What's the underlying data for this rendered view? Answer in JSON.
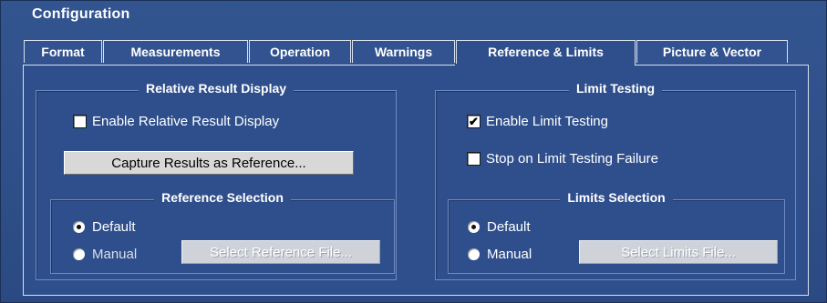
{
  "window": {
    "title": "Configuration"
  },
  "tabs": [
    {
      "label": "Format",
      "active": false
    },
    {
      "label": "Measurements",
      "active": false
    },
    {
      "label": "Operation",
      "active": false
    },
    {
      "label": "Warnings",
      "active": false
    },
    {
      "label": "Reference & Limits",
      "active": true
    },
    {
      "label": "Picture & Vector",
      "active": false
    }
  ],
  "relative": {
    "title": "Relative Result Display",
    "enable_label": "Enable Relative Result Display",
    "enable_checked": false,
    "capture_button": "Capture Results as Reference...",
    "selection": {
      "title": "Reference Selection",
      "default_label": "Default",
      "manual_label": "Manual",
      "selected": "Default",
      "file_button": "Select Reference File..."
    }
  },
  "limits": {
    "title": "Limit Testing",
    "enable_label": "Enable Limit Testing",
    "enable_checked": true,
    "stop_label": "Stop on Limit Testing Failure",
    "stop_checked": false,
    "selection": {
      "title": "Limits Selection",
      "default_label": "Default",
      "manual_label": "Manual",
      "selected": "Default",
      "file_button": "Select Limits File..."
    }
  }
}
